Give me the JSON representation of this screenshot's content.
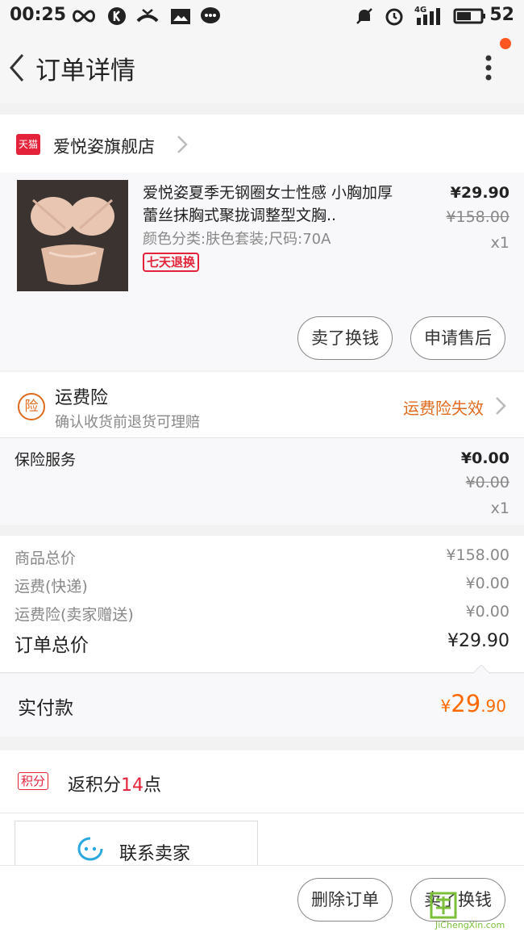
{
  "status_bar": {
    "time": "00:25",
    "battery": "52",
    "network": "4G"
  },
  "header": {
    "title": "订单详情"
  },
  "shop": {
    "badge": "天猫",
    "name": "爱悦姿旗舰店"
  },
  "product": {
    "title": "爱悦姿夏季无钢圈女士性感 小胸加厚蕾丝抹胸式聚拢调整型文胸..",
    "spec": "颜色分类:肤色套装;尺码:70A",
    "tag": "七天退换",
    "price": "¥29.90",
    "original_price": "¥158.00",
    "qty": "x1",
    "buttons": [
      "卖了换钱",
      "申请售后"
    ]
  },
  "shipping_insurance": {
    "icon_text": "险",
    "title": "运费险",
    "subtitle": "确认收货前退货可理赔",
    "status": "运费险失效"
  },
  "insurance_service": {
    "label": "保险服务",
    "price": "¥0.00",
    "original_price": "¥0.00",
    "qty": "x1"
  },
  "summary": {
    "rows": [
      {
        "label": "商品总价",
        "value": "¥158.00"
      },
      {
        "label": "运费(快递)",
        "value": "¥0.00"
      },
      {
        "label": "运费险(卖家赠送)",
        "value": "¥0.00"
      }
    ],
    "total_label": "订单总价",
    "total_value": "¥29.90",
    "paid_label": "实付款",
    "paid_currency": "¥",
    "paid_int": "29",
    "paid_dec": ".90"
  },
  "points": {
    "badge": "积分",
    "prefix": "返积分",
    "count": "14",
    "suffix": "点"
  },
  "contact": {
    "label": "联系卖家"
  },
  "bottom_bar": {
    "buttons": [
      "删除订单",
      "卖了换钱"
    ]
  },
  "watermark": {
    "text": "JiChengXin.com"
  },
  "colors": {
    "accent": "#e4233a",
    "orange": "#ff6a00",
    "tmall_red": "#e4233a"
  }
}
